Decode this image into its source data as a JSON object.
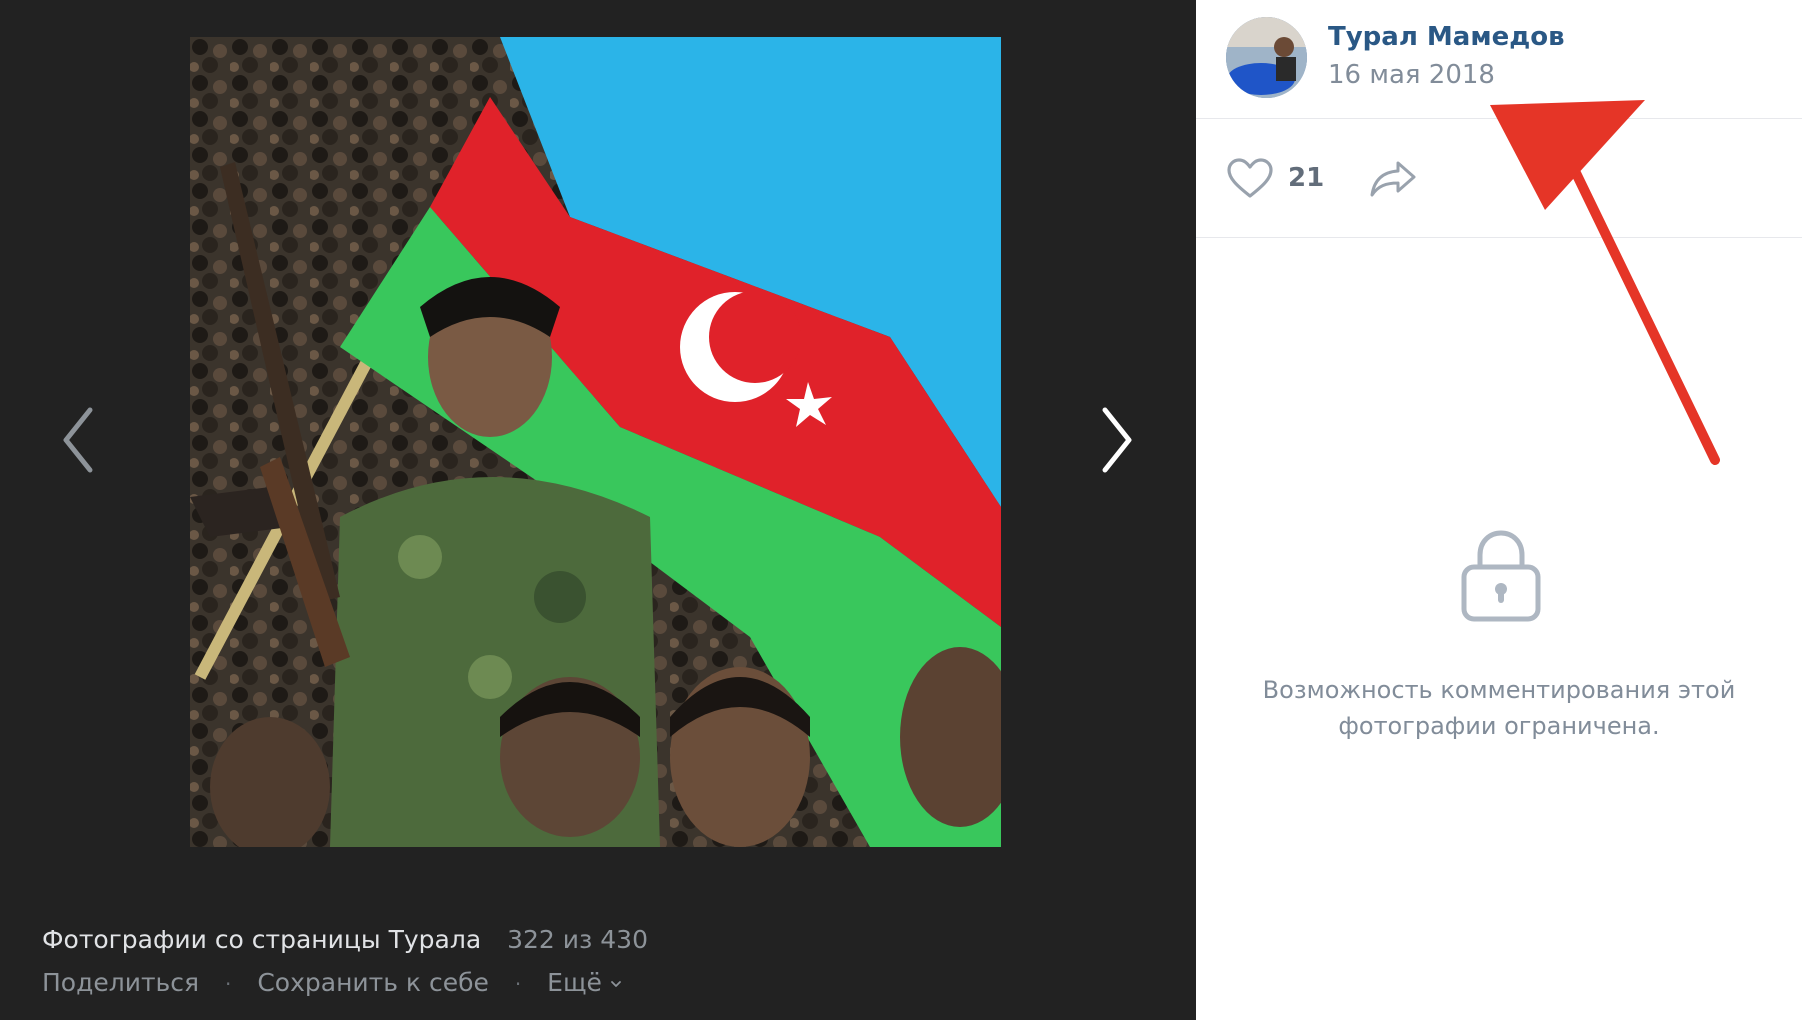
{
  "viewer": {
    "album_title": "Фотографии со страницы Турала",
    "counter": "322 из 430",
    "share_label": "Поделиться",
    "save_label": "Сохранить к себе",
    "more_label": "Ещё",
    "separator": "·"
  },
  "sidebar": {
    "author_name": "Турал Мамедов",
    "date": "16 мая 2018",
    "likes": "21",
    "comments_restricted": "Возможность комментирования этой фотографии ограничена."
  },
  "colors": {
    "viewer_bg": "#222222",
    "link": "#2a5885",
    "muted": "#818c99",
    "annotation_arrow": "#e53527"
  },
  "icons": {
    "prev": "chevron-left-icon",
    "next": "chevron-right-icon",
    "like": "heart-icon",
    "share": "share-arrow-icon",
    "lock": "lock-icon",
    "more": "chevron-down-icon"
  }
}
